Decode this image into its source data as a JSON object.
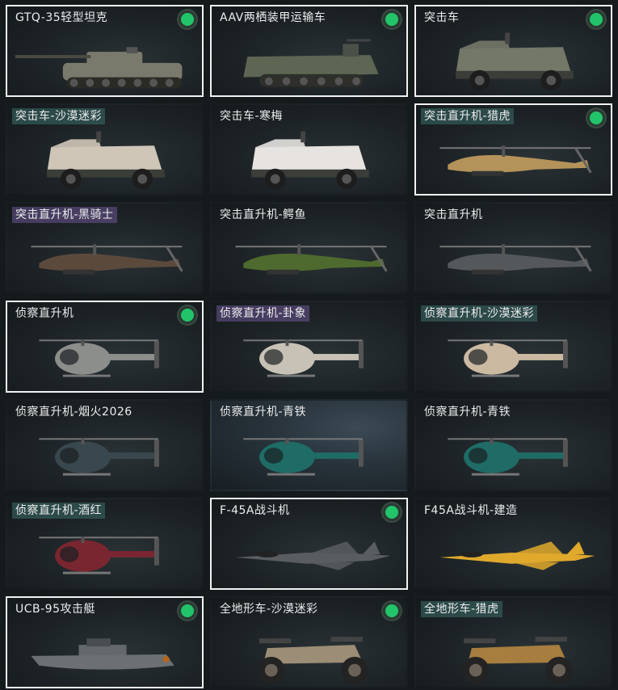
{
  "items": [
    {
      "name": "GTQ-35轻型坦克",
      "selected": true,
      "equipped": true,
      "tag": "none",
      "art": "tank-icon",
      "color": "#7a7a6c"
    },
    {
      "name": "AAV两栖装甲运输车",
      "selected": true,
      "equipped": true,
      "tag": "none",
      "art": "amphibious-vehicle-icon",
      "color": "#5d6653"
    },
    {
      "name": "突击车",
      "selected": true,
      "equipped": true,
      "tag": "none",
      "art": "assault-vehicle-icon",
      "color": "#737868"
    },
    {
      "name": "突击车-沙漠迷彩",
      "selected": false,
      "equipped": false,
      "tag": "teal",
      "art": "assault-vehicle-icon",
      "color": "#cfc6b8"
    },
    {
      "name": "突击车-寒梅",
      "selected": false,
      "equipped": false,
      "tag": "none",
      "art": "assault-vehicle-icon",
      "color": "#e6e3e0"
    },
    {
      "name": "突击直升机-猎虎",
      "selected": true,
      "equipped": true,
      "tag": "teal",
      "art": "attack-helicopter-icon",
      "color": "#b4935a"
    },
    {
      "name": "突击直升机-黑骑士",
      "selected": false,
      "equipped": false,
      "tag": "purple",
      "art": "attack-helicopter-icon",
      "color": "#5b4a3c"
    },
    {
      "name": "突击直升机-鳄鱼",
      "selected": false,
      "equipped": false,
      "tag": "none",
      "art": "attack-helicopter-icon",
      "color": "#4f6a2e"
    },
    {
      "name": "突击直升机",
      "selected": false,
      "equipped": false,
      "tag": "none",
      "art": "attack-helicopter-icon",
      "color": "#55585a"
    },
    {
      "name": "侦察直升机",
      "selected": true,
      "equipped": true,
      "tag": "none",
      "art": "scout-helicopter-icon",
      "color": "#8c8e8c"
    },
    {
      "name": "侦察直升机-卦象",
      "selected": false,
      "equipped": false,
      "tag": "purple",
      "art": "scout-helicopter-icon",
      "color": "#c8c2b6"
    },
    {
      "name": "侦察直升机-沙漠迷彩",
      "selected": false,
      "equipped": false,
      "tag": "teal",
      "art": "scout-helicopter-icon",
      "color": "#cbb9a2"
    },
    {
      "name": "侦察直升机-烟火2026",
      "selected": false,
      "equipped": false,
      "tag": "none",
      "art": "scout-helicopter-icon",
      "color": "#39474e"
    },
    {
      "name": "侦察直升机-青铁",
      "selected": false,
      "equipped": false,
      "tag": "none",
      "art": "scout-helicopter-icon",
      "color": "#1f6b66",
      "glow": true
    },
    {
      "name": "侦察直升机-青铁",
      "selected": false,
      "equipped": false,
      "tag": "none",
      "art": "scout-helicopter-icon",
      "color": "#1f6b66"
    },
    {
      "name": "侦察直升机-酒红",
      "selected": false,
      "equipped": false,
      "tag": "teal",
      "art": "scout-helicopter-icon",
      "color": "#7a2630"
    },
    {
      "name": "F-45A战斗机",
      "selected": true,
      "equipped": true,
      "tag": "none",
      "art": "fighter-jet-icon",
      "color": "#5a5d60"
    },
    {
      "name": "F45A战斗机-建造",
      "selected": false,
      "equipped": false,
      "tag": "none",
      "art": "fighter-jet-icon",
      "color": "#e0a92c"
    },
    {
      "name": "UCB-95攻击艇",
      "selected": true,
      "equipped": true,
      "tag": "none",
      "art": "attack-boat-icon",
      "color": "#6c7072"
    },
    {
      "name": "全地形车-沙漠迷彩",
      "selected": false,
      "equipped": true,
      "tag": "none",
      "art": "atv-icon",
      "color": "#9c8d76"
    },
    {
      "name": "全地形车-猎虎",
      "selected": false,
      "equipped": false,
      "tag": "teal",
      "art": "atv-icon",
      "color": "#a77e3f"
    }
  ]
}
